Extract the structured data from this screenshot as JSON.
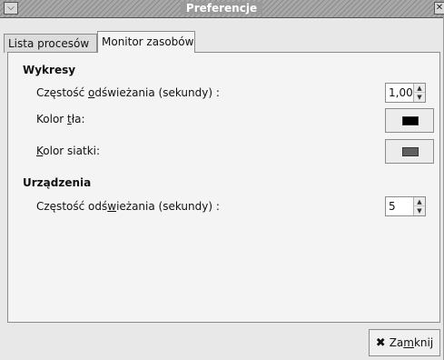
{
  "window": {
    "title": "Preferencje",
    "menu_icon": "chevron-down-icon",
    "close_icon": "close-icon"
  },
  "tabs": [
    {
      "label": "Lista procesów",
      "selected": false
    },
    {
      "label": "Monitor zasobów",
      "selected": true
    }
  ],
  "graphs": {
    "section_title": "Wykresy",
    "refresh": {
      "label_before": "Częstość ",
      "label_mnemonic": "o",
      "label_after": "dświeżania (sekundy) :",
      "value": "1,00"
    },
    "bg_color": {
      "label_before": "Kolor ",
      "label_mnemonic": "t",
      "label_after": "ła:",
      "color": "#000000"
    },
    "grid_color": {
      "label_mnemonic": "K",
      "label_after": "olor siatki:",
      "color": "#606060"
    }
  },
  "devices": {
    "section_title": "Urządzenia",
    "refresh": {
      "label_before": "Częstość odś",
      "label_mnemonic": "w",
      "label_after": "ieżania (sekundy) :",
      "value": "5"
    }
  },
  "footer": {
    "close_before": "Za",
    "close_mnemonic": "m",
    "close_after": "knij",
    "close_icon": "x-icon"
  }
}
